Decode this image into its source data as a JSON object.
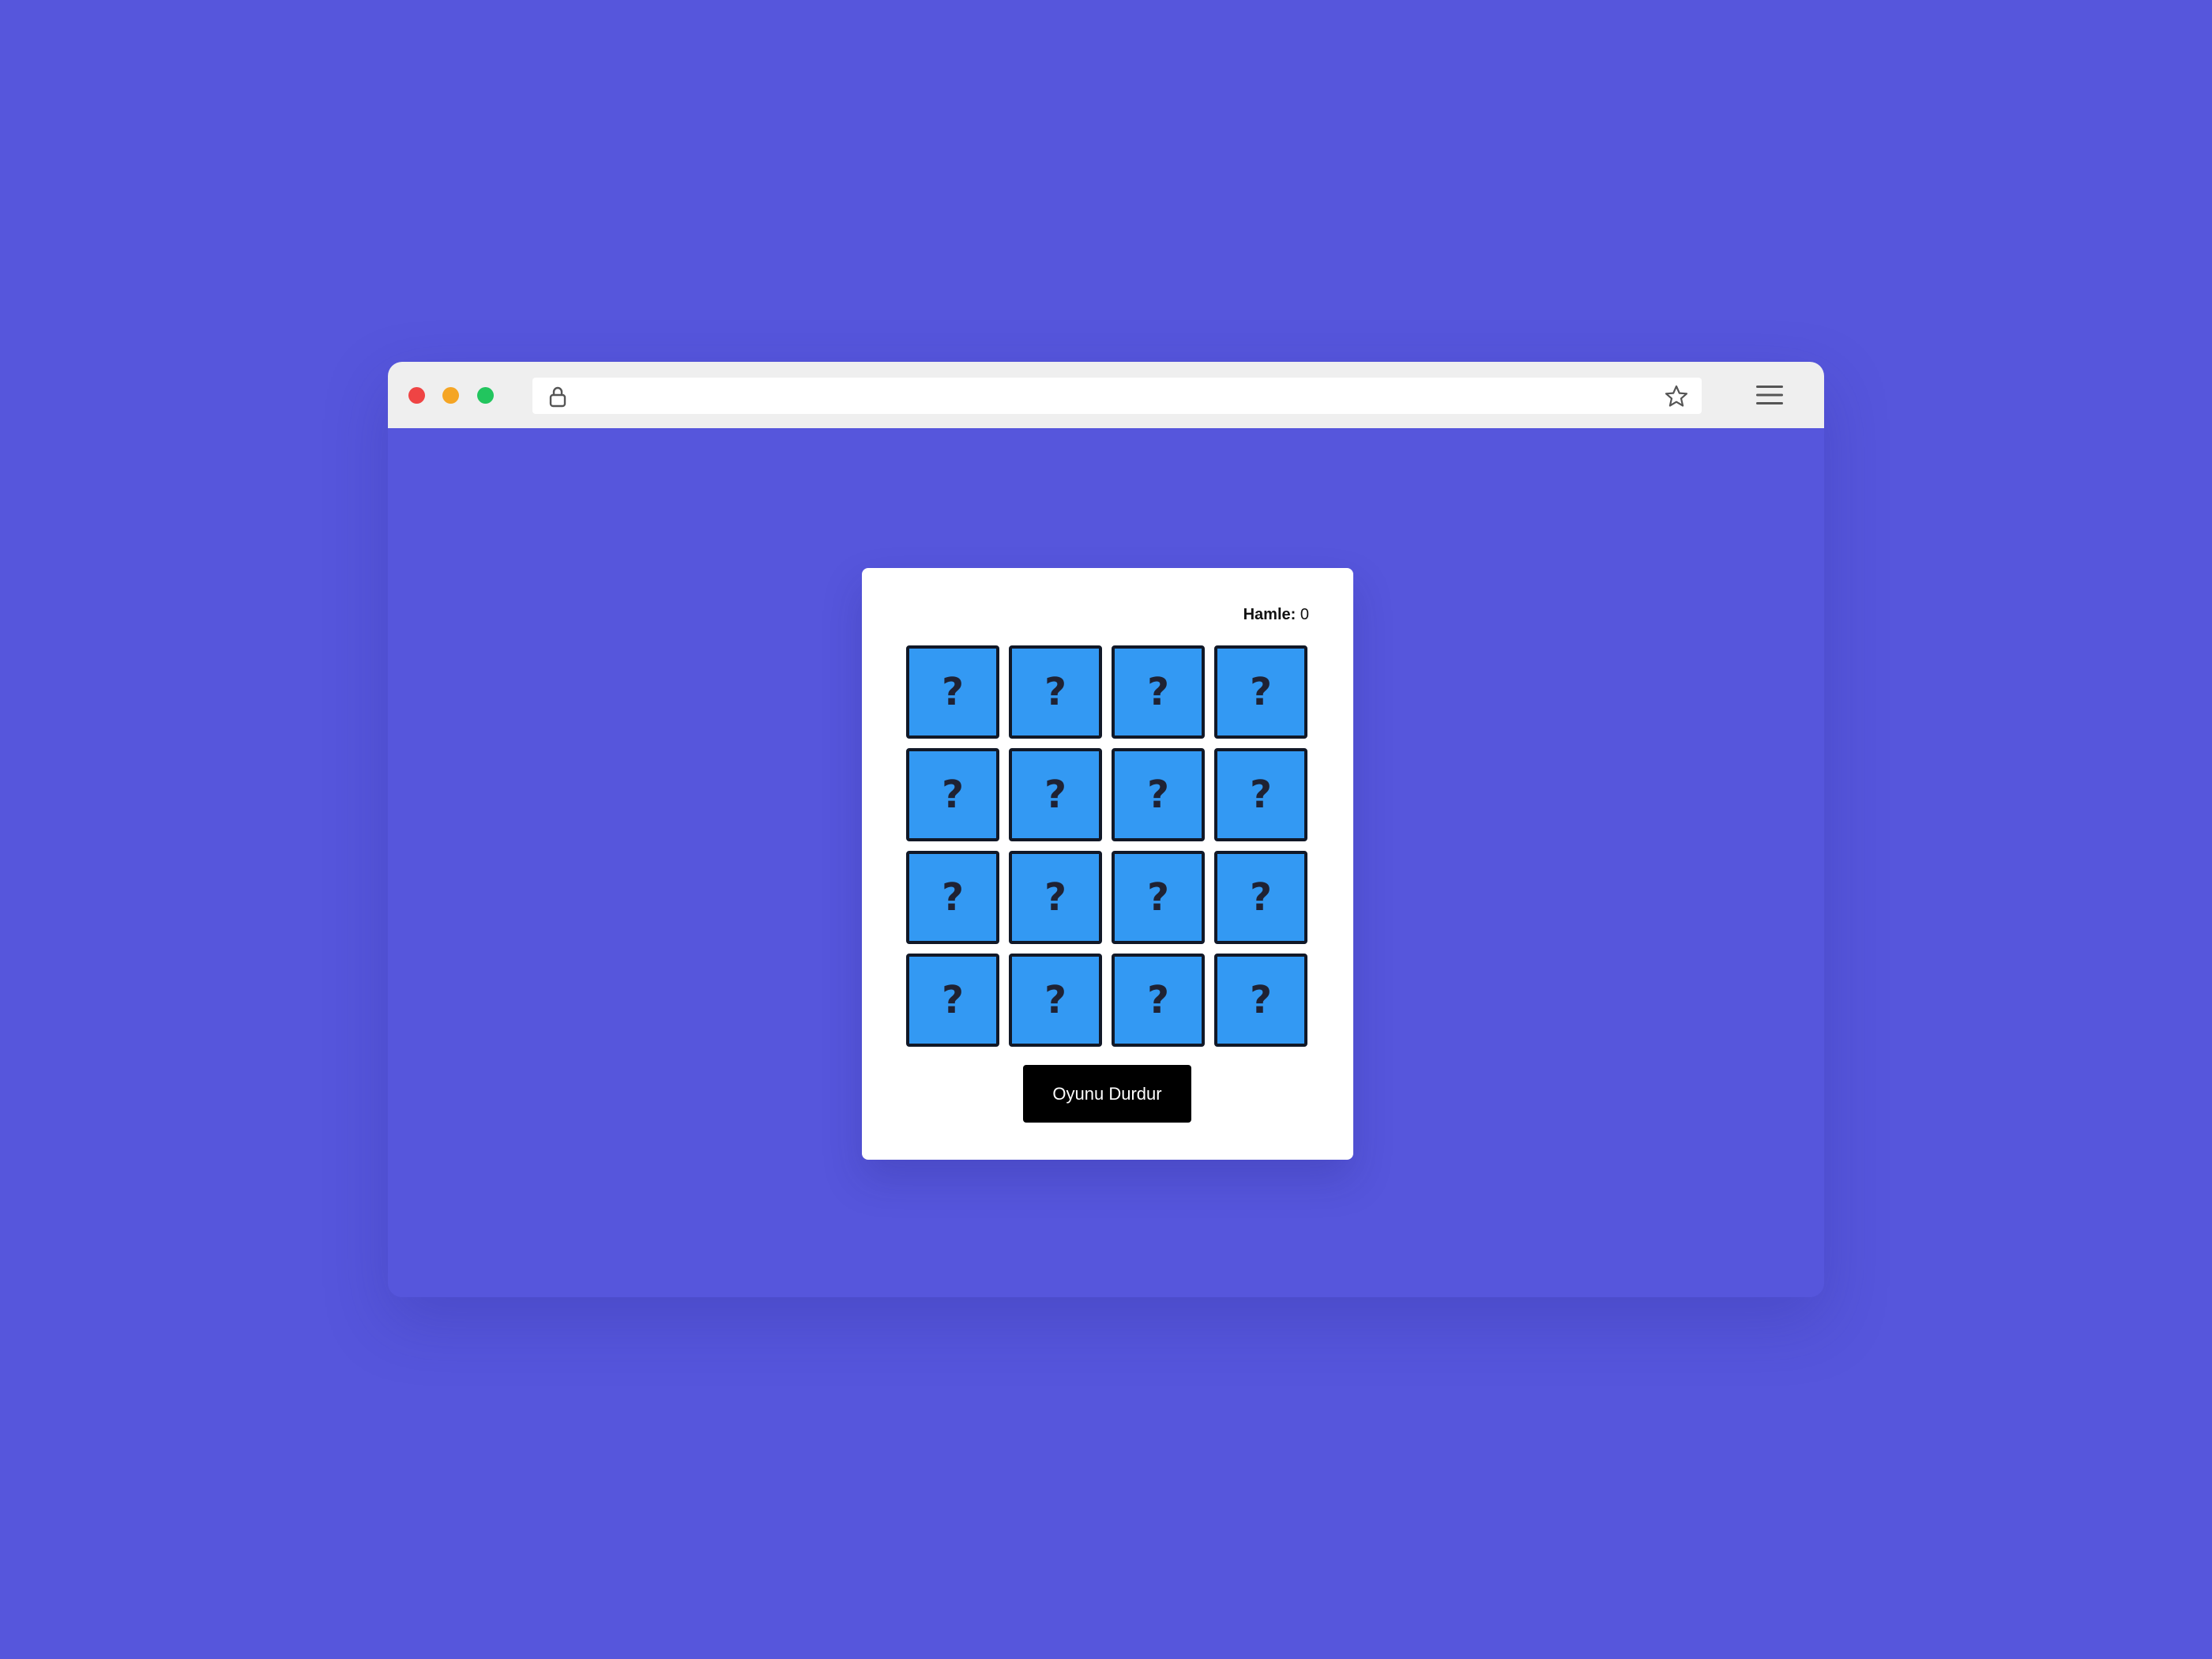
{
  "browser": {
    "window_controls": [
      "close",
      "minimize",
      "maximize"
    ],
    "icons": {
      "lock": "lock-icon",
      "bookmark": "star-icon",
      "menu": "hamburger-menu-icon"
    }
  },
  "game": {
    "moves_label": "Hamle:",
    "moves_value": "0",
    "tiles": [
      "?",
      "?",
      "?",
      "?",
      "?",
      "?",
      "?",
      "?",
      "?",
      "?",
      "?",
      "?",
      "?",
      "?",
      "?",
      "?"
    ],
    "grid_columns": 4,
    "grid_rows": 4,
    "stop_button_label": "Oyunu Durdur"
  },
  "colors": {
    "background": "#5656dc",
    "tile": "#3399f3",
    "tile_border": "#111827",
    "button": "#000000",
    "button_text": "#ffffff"
  }
}
